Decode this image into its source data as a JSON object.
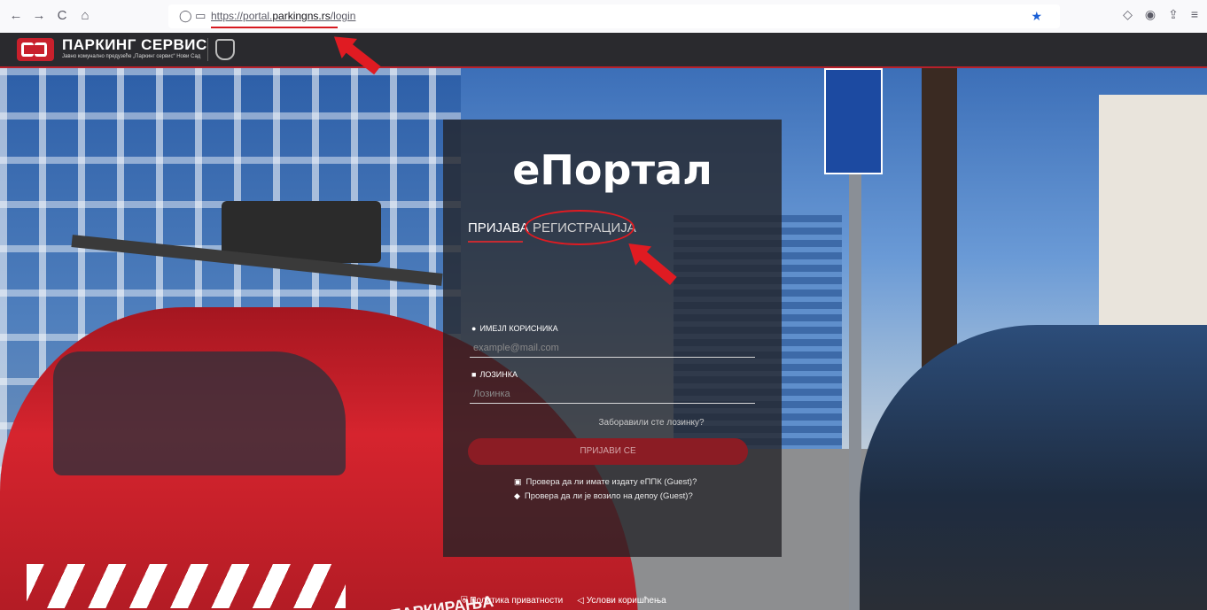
{
  "browser": {
    "back": "←",
    "forward": "→",
    "reload": "C",
    "home": "⌂",
    "url_prefix": "https://portal.",
    "url_domain": "parkingns.rs",
    "url_path": "/login"
  },
  "header": {
    "logo_title": "ПАРКИНГ СЕРВИС",
    "logo_subtitle": "Јавно комунално предузеће „Паркинг сервис“ Нови Сад"
  },
  "login": {
    "portal_title": "еПортал",
    "tab_login": "ПРИЈАВА",
    "tab_register": "РЕГИСТРАЦИЈА",
    "email_label": "ИМЕЈЛ КОРИСНИКА",
    "email_placeholder": "example@mail.com",
    "password_label": "ЛОЗИНКА",
    "password_placeholder": "Лозинка",
    "forgot": "Заборавили сте лозинку?",
    "submit": "ПРИЈАВИ СЕ",
    "guest_check_1": "Провера да ли имате издату еППК (Guest)?",
    "guest_check_2": "Провера да ли је возило на депоу (Guest)?"
  },
  "scene": {
    "car_text": "ПАРКИРАЊА"
  },
  "footer": {
    "privacy": "Политика приватности",
    "terms": "Услови коришћења"
  },
  "colors": {
    "accent_red": "#c62b32",
    "annotation_red": "#e01b22",
    "header_bg": "#2a2a2e"
  }
}
